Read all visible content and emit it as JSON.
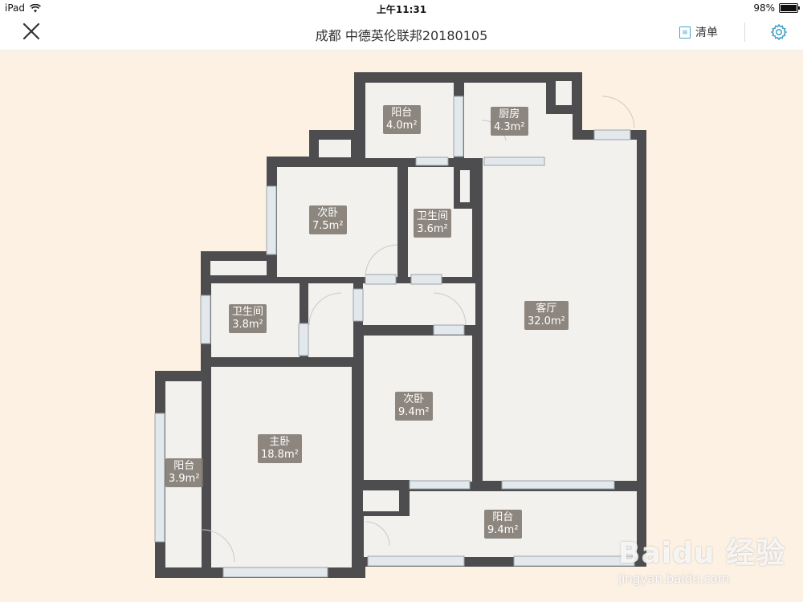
{
  "status_bar": {
    "device": "iPad",
    "time": "上午11:31",
    "battery": "98%",
    "battery_level": 0.98
  },
  "nav": {
    "title": "成都 中德英伦联邦20180105",
    "list_label": "清单",
    "list_icon_glyph": "≡"
  },
  "rooms": [
    {
      "id": "balcony-north",
      "name": "阳台",
      "area": "4.0m²"
    },
    {
      "id": "kitchen",
      "name": "厨房",
      "area": "4.3m²"
    },
    {
      "id": "bedroom-second-top",
      "name": "次卧",
      "area": "7.5m²"
    },
    {
      "id": "bathroom-top",
      "name": "卫生间",
      "area": "3.6m²"
    },
    {
      "id": "bathroom-left",
      "name": "卫生间",
      "area": "3.8m²"
    },
    {
      "id": "living-room",
      "name": "客厅",
      "area": "32.0m²"
    },
    {
      "id": "bedroom-second-mid",
      "name": "次卧",
      "area": "9.4m²"
    },
    {
      "id": "master-bedroom",
      "name": "主卧",
      "area": "18.8m²"
    },
    {
      "id": "balcony-west",
      "name": "阳台",
      "area": "3.9m²"
    },
    {
      "id": "balcony-south",
      "name": "阳台",
      "area": "9.4m²"
    }
  ],
  "colors": {
    "canvas": "#fdf1e3",
    "wall": "#4d4d4f",
    "floor": "#f3f1ee",
    "label": "#7d766e",
    "window": "#dfe6ea"
  },
  "watermark": {
    "logo": "Baidu 经验",
    "url": "jingyan.baidu.com"
  }
}
